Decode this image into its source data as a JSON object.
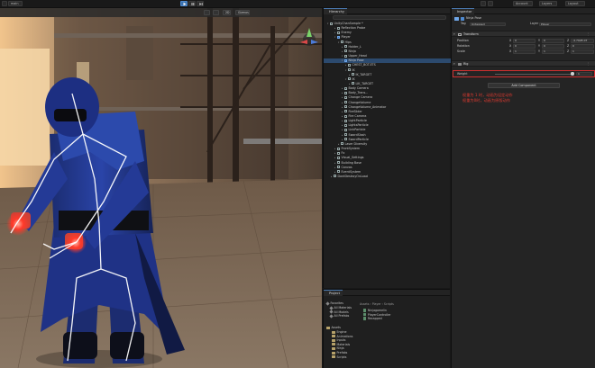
{
  "toolbar": {
    "branch": "main",
    "account": "Account",
    "layers": "Layers",
    "layout": "Layout",
    "gizmo_mode": "Gizmos"
  },
  "scene": {
    "tab_label": "Scene",
    "shading": "Shaded",
    "view_2d": "2D"
  },
  "hierarchy": {
    "tab_label": "Hierarchy",
    "items": [
      {
        "label": "UnityChanSample *",
        "indent": 0,
        "expanded": true,
        "icon": "scene",
        "selected": false
      },
      {
        "label": "Reflection Probe",
        "indent": 2,
        "expanded": false,
        "icon": "cube",
        "selected": false
      },
      {
        "label": "Enemy",
        "indent": 2,
        "expanded": false,
        "icon": "cube",
        "selected": false
      },
      {
        "label": "Player",
        "indent": 2,
        "expanded": true,
        "icon": "cube-blue",
        "selected": false
      },
      {
        "label": "Hips",
        "indent": 3,
        "expanded": true,
        "icon": "cube",
        "selected": false
      },
      {
        "label": "Holder_L",
        "indent": 4,
        "expanded": false,
        "icon": "cube",
        "selected": false
      },
      {
        "label": "Ninja",
        "indent": 4,
        "expanded": false,
        "icon": "cube",
        "selected": false
      },
      {
        "label": "Upper_Head",
        "indent": 4,
        "expanded": true,
        "icon": "cube",
        "selected": false
      },
      {
        "label": "Ninja Pose",
        "indent": 4,
        "expanded": true,
        "icon": "cube-blue",
        "selected": true
      },
      {
        "label": "CHEST_BOT.ETS",
        "indent": 5,
        "expanded": false,
        "icon": "cube",
        "selected": false
      },
      {
        "label": "IK",
        "indent": 5,
        "expanded": true,
        "icon": "cube",
        "selected": false
      },
      {
        "label": "IK_TARGET",
        "indent": 6,
        "expanded": false,
        "icon": "cube",
        "selected": false
      },
      {
        "label": "IK",
        "indent": 5,
        "expanded": true,
        "icon": "cube",
        "selected": false
      },
      {
        "label": "LIK_TARGET",
        "indent": 6,
        "expanded": false,
        "icon": "cube",
        "selected": false
      },
      {
        "label": "Body Camera",
        "indent": 4,
        "expanded": false,
        "icon": "cube",
        "selected": false
      },
      {
        "label": "Body_Trans...",
        "indent": 4,
        "expanded": false,
        "icon": "cube",
        "selected": false
      },
      {
        "label": "Change Camera",
        "indent": 4,
        "expanded": false,
        "icon": "cube",
        "selected": false
      },
      {
        "label": "ChangeVolume",
        "indent": 4,
        "expanded": false,
        "icon": "cube",
        "selected": false
      },
      {
        "label": "ChangeVolume_Animator",
        "indent": 4,
        "expanded": false,
        "icon": "cube",
        "selected": false
      },
      {
        "label": "FireSlider",
        "indent": 4,
        "expanded": false,
        "icon": "cube",
        "selected": false
      },
      {
        "label": "Fire Camera",
        "indent": 4,
        "expanded": false,
        "icon": "cube",
        "selected": false
      },
      {
        "label": "LightParticle",
        "indent": 4,
        "expanded": false,
        "icon": "cube",
        "selected": false
      },
      {
        "label": "LightsParticle",
        "indent": 4,
        "expanded": false,
        "icon": "cube",
        "selected": false
      },
      {
        "label": "LinkParticle",
        "indent": 4,
        "expanded": false,
        "icon": "cube",
        "selected": false
      },
      {
        "label": "SwordSlash",
        "indent": 4,
        "expanded": false,
        "icon": "cube",
        "selected": false
      },
      {
        "label": "SwordParticle",
        "indent": 4,
        "expanded": false,
        "icon": "cube",
        "selected": false
      },
      {
        "label": "Laser Diversity",
        "indent": 3,
        "expanded": false,
        "icon": "cube",
        "selected": false
      },
      {
        "label": "FrontSystem",
        "indent": 2,
        "expanded": false,
        "icon": "cube",
        "selected": false
      },
      {
        "label": "Fx",
        "indent": 2,
        "expanded": false,
        "icon": "cube",
        "selected": false
      },
      {
        "label": "Visual_Settings",
        "indent": 2,
        "expanded": false,
        "icon": "cube",
        "selected": false
      },
      {
        "label": "Building Base",
        "indent": 2,
        "expanded": false,
        "icon": "cube",
        "selected": false
      },
      {
        "label": "Canvas",
        "indent": 2,
        "expanded": false,
        "icon": "cube",
        "selected": false
      },
      {
        "label": "EventSystem",
        "indent": 2,
        "expanded": false,
        "icon": "cube",
        "selected": false
      },
      {
        "label": "DontDestroyOnLoad",
        "indent": 1,
        "expanded": false,
        "icon": "scene",
        "selected": false
      }
    ]
  },
  "inspector": {
    "tab_label": "Inspector",
    "object_name": "Ninja Pose",
    "tag_label": "Tag",
    "tag_value": "Untagged",
    "layer_label": "Layer",
    "layer_value": "Player",
    "transform_label": "Transform",
    "position_label": "Position",
    "rotation_label": "Rotation",
    "scale_label": "Scale",
    "position": {
      "x": "0",
      "y": "0",
      "z": "-4.702E-07"
    },
    "rotation": {
      "x": "0",
      "y": "0",
      "z": "0"
    },
    "scale": {
      "x": "1",
      "y": "1",
      "z": "1"
    },
    "rig_label": "Rig",
    "weight_label": "Weight",
    "weight_value": 1,
    "add_component": "Add Component",
    "note_line1": "权重为 1 时，动画为设定动作",
    "note_line2": "权重为0时，动画为原版动作",
    "highlight_color": "#d03030"
  },
  "project": {
    "tab_label": "Project",
    "favorites_label": "Favorites",
    "favorites": [
      "All Materials",
      "All Models",
      "All Prefabs"
    ],
    "breadcrumb": [
      "Assets",
      "Player",
      "Scripts"
    ],
    "files": [
      "Ninjagamelin",
      "PlayerController",
      "Recapped"
    ],
    "assets_label": "Assets",
    "assets_tree": [
      "Engine",
      "Animations",
      "Inputs",
      "Materials",
      "Ninja",
      "Prefabs",
      "Scripts"
    ]
  }
}
